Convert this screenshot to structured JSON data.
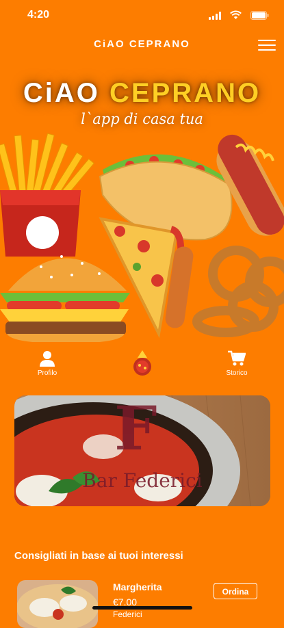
{
  "status_bar": {
    "time": "4:20"
  },
  "header": {
    "logo_text": "CiAO CEPRANO",
    "menu_icon": "hamburger-icon"
  },
  "hero": {
    "title_part1": "CiAO",
    "title_part2": "CEPRANO",
    "tagline": "l`app di casa tua",
    "accent_color": "#ffcf24"
  },
  "quick_nav": {
    "items": [
      {
        "label": "Profilo",
        "icon": "user-icon"
      },
      {
        "label": "",
        "icon": "ciao-ceprano-emblem-icon"
      },
      {
        "label": "Storico",
        "icon": "cart-icon"
      }
    ]
  },
  "banner": {
    "venue_name": "Bar Federici",
    "logo_letter": "F"
  },
  "recommendations": {
    "section_title": "Consigliati in base ai tuoi interessi",
    "items": [
      {
        "name": "Margherita",
        "price": "€7.00",
        "venue": "Federici",
        "order_label": "Ordina"
      }
    ]
  },
  "colors": {
    "background": "#fd7d00",
    "text": "#ffffff"
  }
}
